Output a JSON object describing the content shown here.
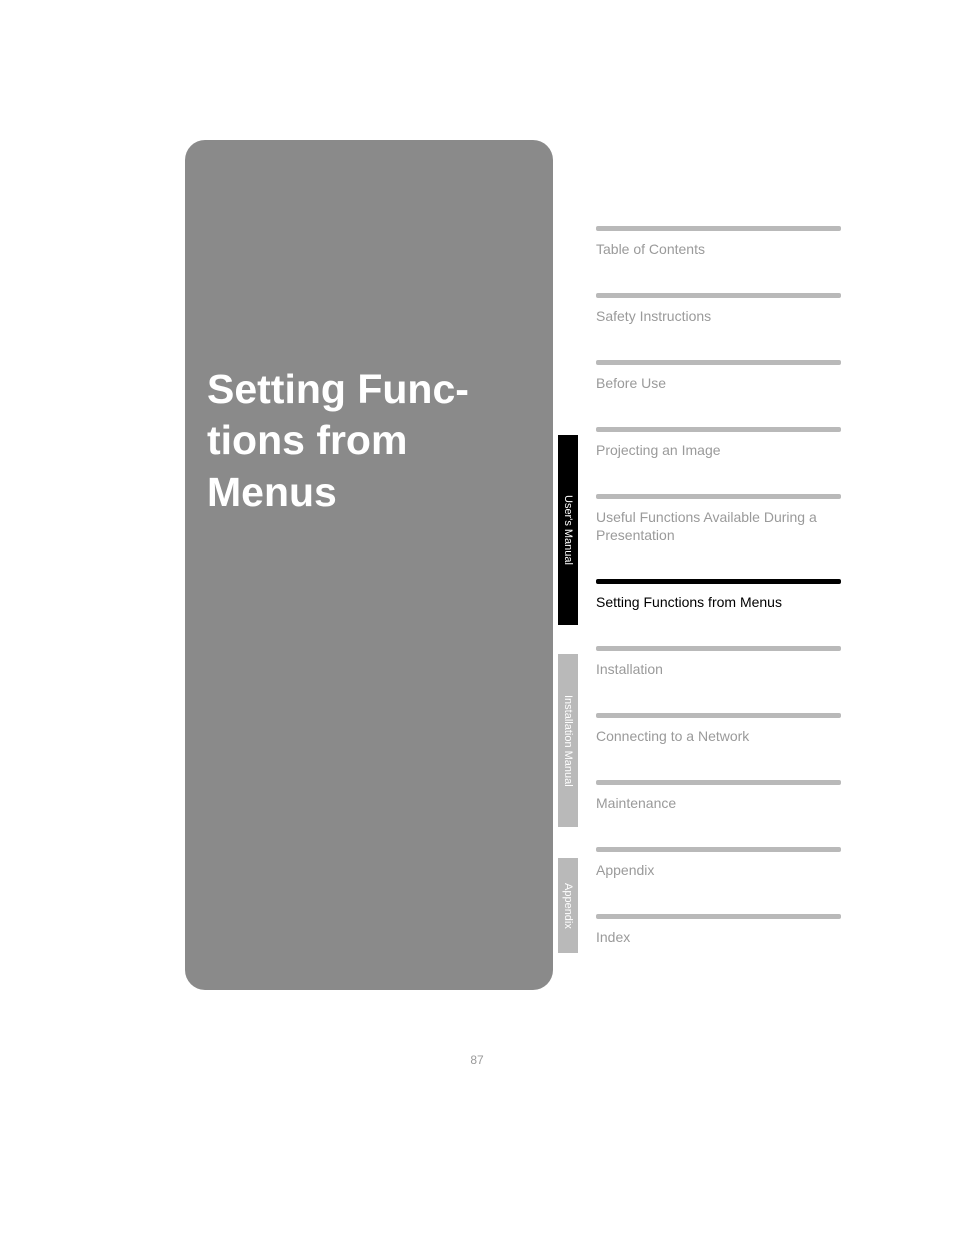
{
  "main": {
    "title": "Setting Func-\ntions from Menus"
  },
  "tabs": {
    "users": "User's Manual",
    "install": "Installation Manual",
    "appendix": "Appendix"
  },
  "nav": [
    {
      "label": "Table of Contents",
      "active": false
    },
    {
      "label": "Safety Instructions",
      "active": false
    },
    {
      "label": "Before Use",
      "active": false
    },
    {
      "label": "Projecting an Image",
      "active": false
    },
    {
      "label": "Useful Functions Available During a Presentation",
      "active": false
    },
    {
      "label": "Setting Functions from Menus",
      "active": true
    },
    {
      "label": "Installation",
      "active": false
    },
    {
      "label": "Connecting to a Network",
      "active": false
    },
    {
      "label": "Maintenance",
      "active": false
    },
    {
      "label": "Appendix",
      "active": false
    },
    {
      "label": "Index",
      "active": false
    }
  ],
  "page_number": "87"
}
